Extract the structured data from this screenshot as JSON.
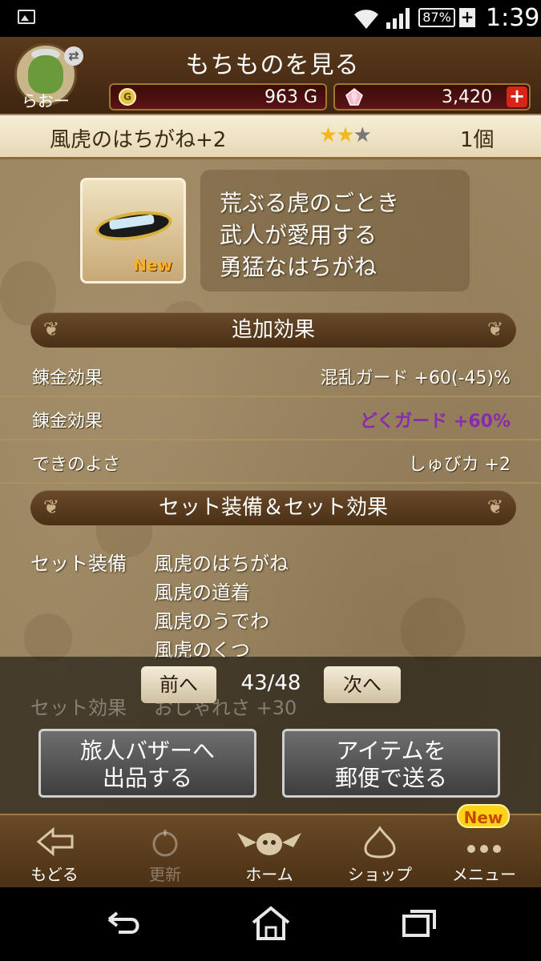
{
  "status_bar": {
    "battery": "87%",
    "time": "1:39"
  },
  "header": {
    "title": "もちものを見る",
    "player_name": "らおー",
    "gold_value": "963 G",
    "gem_value": "3,420"
  },
  "item": {
    "name": "風虎のはちがね+2",
    "stars_filled": 2,
    "stars_total": 3,
    "count": "1個",
    "new_label": "New",
    "description": [
      "荒ぶる虎のごとき",
      "武人が愛用する",
      "勇猛なはちがね"
    ]
  },
  "extra_effects": {
    "heading": "追加効果",
    "rows": [
      {
        "label": "錬金効果",
        "value": "混乱ガード +60(-45)%"
      },
      {
        "label": "錬金効果",
        "value": "どくガード +60%"
      },
      {
        "label": "できのよさ",
        "value": "しゅびカ +2"
      }
    ]
  },
  "set": {
    "heading": "セット装備＆セット効果",
    "equip_label": "セット装備",
    "items": [
      "風虎のはちがね",
      "風虎の道着",
      "風虎のうでわ",
      "風虎のくつ"
    ],
    "effect_label": "セット効果",
    "effect_partial": "おしゃれさ +30"
  },
  "pager": {
    "prev": "前へ",
    "counter": "43/48",
    "next": "次へ"
  },
  "actions": {
    "bazaar": [
      "旅人バザーへ",
      "出品する"
    ],
    "mail": [
      "アイテムを",
      "郵便で送る"
    ]
  },
  "bottom_nav": {
    "back": "もどる",
    "refresh": "更新",
    "home": "ホーム",
    "shop": "ショップ",
    "menu": "メニュー",
    "menu_badge": "New"
  },
  "colors": {
    "accent_purple": "#8a2ab0",
    "gold": "#f2b91c",
    "plus_red": "#d6261a"
  }
}
